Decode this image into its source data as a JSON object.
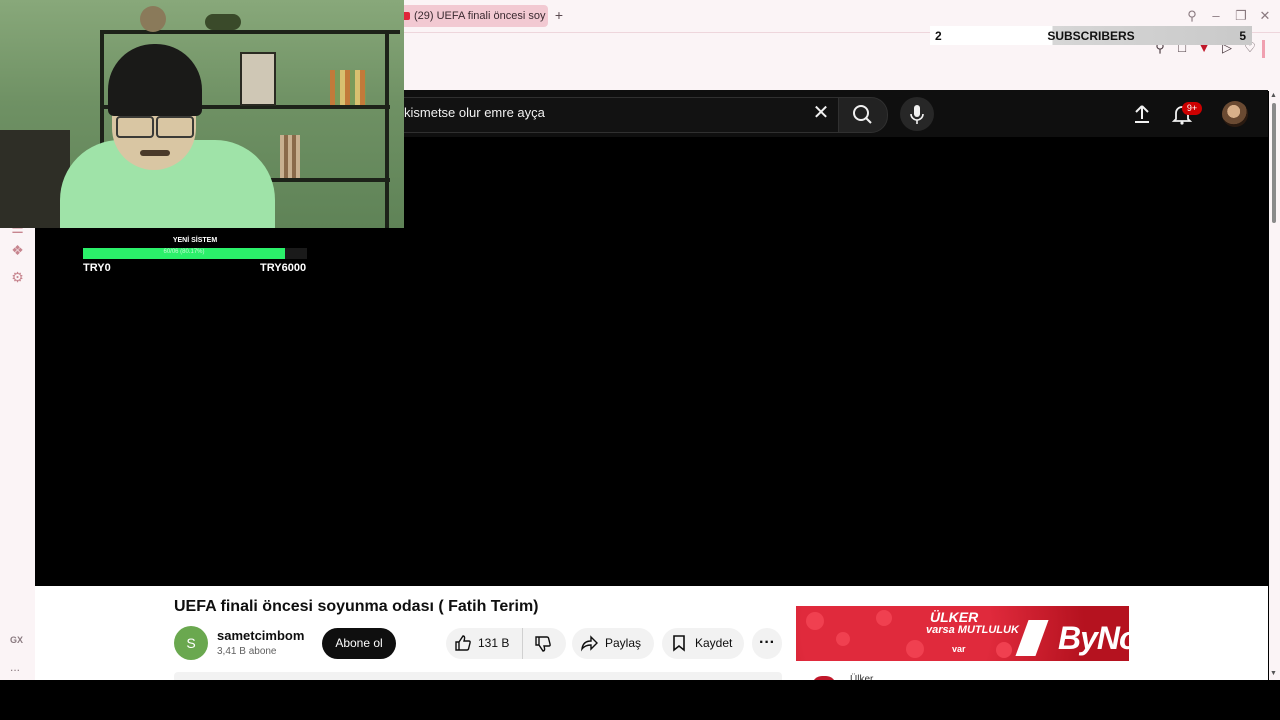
{
  "browser": {
    "tab_title": "(29) UEFA finali öncesi soy",
    "new_tab_symbol": "+",
    "window_buttons": [
      "search-icon",
      "minimize-icon",
      "restore-icon",
      "close-icon"
    ],
    "accent": "#f2c9d2"
  },
  "subscriber_widget": {
    "current": "2",
    "label": "SUBSCRIBERS",
    "goal": "5"
  },
  "stream_goal": {
    "title": "YENİ SİSTEM",
    "progress_text": "60/06 (80.17%)",
    "progress": 0.9,
    "min_label": "TRY0",
    "max_label": "TRY6000",
    "fill_color": "#2bf06a"
  },
  "youtube": {
    "search_query": "kismetse olur emre ayça",
    "notification_badge": "9+"
  },
  "video": {
    "title": "UEFA finali öncesi soyunma odası ( Fatih Terim)",
    "channel_initial": "S",
    "channel_name": "sametcimbom",
    "channel_subs": "3,41 B abone",
    "subscribe_label": "Abone ol",
    "like_count": "131 B",
    "share_label": "Paylaş",
    "save_label": "Kaydet"
  },
  "ad": {
    "brand": "ÜLKER",
    "line2": "varsa MUTLULUK",
    "line3": "var",
    "product": "ByNo",
    "sub_text": "Ülker"
  },
  "sidebar": {
    "gx_label": "GX",
    "more_label": "..."
  }
}
